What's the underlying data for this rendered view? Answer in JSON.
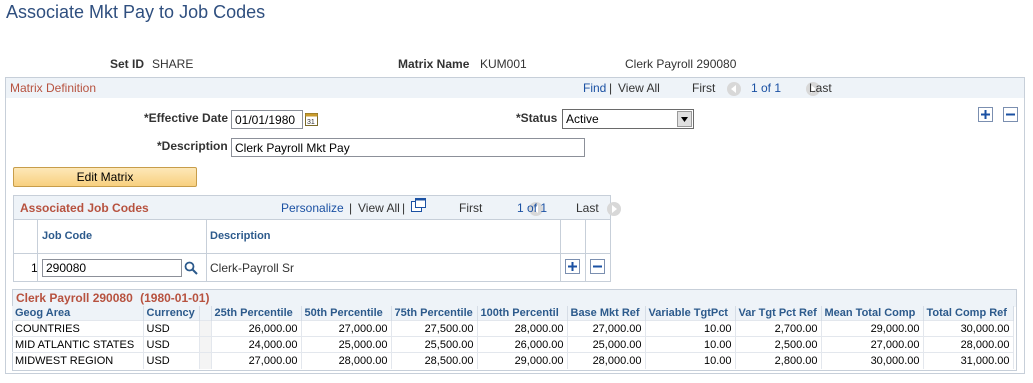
{
  "page": {
    "title": "Associate Mkt Pay to Job Codes"
  },
  "header": {
    "setid_label": "Set ID",
    "setid_value": "SHARE",
    "matrix_name_label": "Matrix Name",
    "matrix_name_value": "KUM001",
    "matrix_desc": "Clerk Payroll 290080"
  },
  "matrix_definition": {
    "title": "Matrix Definition",
    "nav": {
      "find": "Find",
      "sep": "|",
      "view_all": "View All",
      "first": "First",
      "range": "1 of 1",
      "last": "Last"
    },
    "effective_date_label": "*Effective Date",
    "effective_date": "01/01/1980",
    "status_label": "*Status",
    "status_value": "Active",
    "description_label": "*Description",
    "description_value": "Clerk Payroll Mkt Pay",
    "edit_matrix_label": "Edit Matrix"
  },
  "job_codes": {
    "title": "Associated Job Codes",
    "nav": {
      "personalize": "Personalize",
      "sep": "|",
      "view_all": "View All",
      "sep2": "|",
      "first": "First",
      "range": "1 of 1",
      "last": "Last"
    },
    "columns": [
      "Job Code",
      "Description"
    ],
    "rows": [
      {
        "num": "1",
        "job_code": "290080",
        "description": "Clerk-Payroll Sr"
      }
    ]
  },
  "market": {
    "title": "Clerk Payroll 290080",
    "date": "(1980-01-01)",
    "columns": [
      "Geog Area",
      "Currency",
      "",
      "25th Percentile",
      "50th Percentile",
      "75th Percentile",
      "100th Percentil",
      "Base Mkt Ref",
      "Variable TgtPct",
      "Var Tgt Pct Ref",
      "Mean Total Comp",
      "Total Comp Ref"
    ],
    "rows": [
      [
        "COUNTRIES",
        "USD",
        "",
        "26,000.00",
        "27,000.00",
        "27,500.00",
        "28,000.00",
        "27,000.00",
        "10.00",
        "2,700.00",
        "29,000.00",
        "30,000.00"
      ],
      [
        "MID ATLANTIC STATES",
        "USD",
        "",
        "24,000.00",
        "25,000.00",
        "25,500.00",
        "26,000.00",
        "25,000.00",
        "10.00",
        "2,500.00",
        "27,000.00",
        "28,000.00"
      ],
      [
        "MIDWEST REGION",
        "USD",
        "",
        "27,000.00",
        "28,000.00",
        "28,500.00",
        "29,000.00",
        "28,000.00",
        "10.00",
        "2,800.00",
        "30,000.00",
        "31,000.00"
      ]
    ]
  },
  "colors": {
    "title_blue": "#2f4f7f",
    "section_title": "#b7523f",
    "link": "#1b51a3",
    "header_bg": "#eef3f8"
  }
}
